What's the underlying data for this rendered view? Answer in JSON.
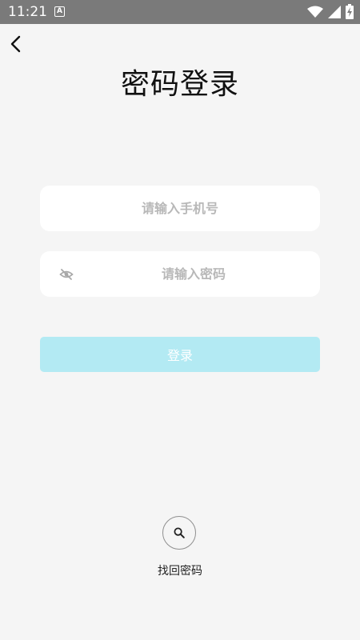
{
  "status_bar": {
    "time": "11:21",
    "notification_icon_letter": "A",
    "icons": [
      "a-notification-icon",
      "wifi-icon",
      "signal-icon",
      "battery-charging-icon"
    ],
    "color": "#7a7a7a"
  },
  "header": {
    "back_icon": "chevron-left-icon",
    "title": "密码登录"
  },
  "form": {
    "phone": {
      "value": "",
      "placeholder": "请输入手机号"
    },
    "password": {
      "value": "",
      "placeholder": "请输入密码",
      "visibility_icon": "eye-off-icon"
    },
    "login_label": "登录",
    "login_color": "#b3eaf3"
  },
  "footer": {
    "find_password_icon": "search-icon",
    "find_password_label": "找回密码"
  }
}
